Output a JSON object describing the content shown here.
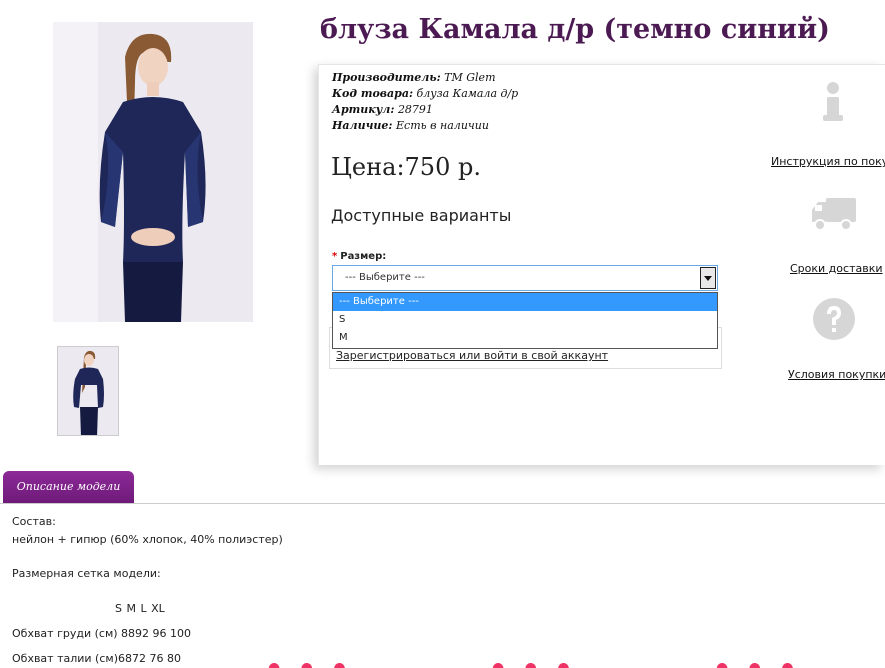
{
  "product": {
    "title": "блуза Камала д/р (темно синий)",
    "specs": [
      {
        "label": "Производитель:",
        "value": "TM Glem"
      },
      {
        "label": "Код товара:",
        "value": "блуза Камала д/р"
      },
      {
        "label": "Артикул:",
        "value": "28791"
      },
      {
        "label": "Наличие:",
        "value": "Есть в наличии"
      }
    ],
    "price": "Цена:750 р.",
    "variants_title": "Доступные варианты",
    "size_label": "Размер:",
    "size_required_mark": "*",
    "select_value": "--- Выберите ---",
    "select_options": [
      "--- Выберите ---",
      "S",
      "M"
    ],
    "login_link": "Зарегистрироваться или войти в свой аккаунт"
  },
  "sidebar": {
    "items": [
      {
        "icon": "info-icon",
        "label": "Инструкция по покуп"
      },
      {
        "icon": "truck-icon",
        "label": "Сроки доставки"
      },
      {
        "icon": "question-icon",
        "label": "Условия покупки"
      }
    ]
  },
  "tabs": {
    "description_label": "Описание модели"
  },
  "description": {
    "composition_label": "Состав:",
    "composition_value": "нейлон + гипюр (60% хлопок, 40% полиэстер)",
    "size_grid_label": "Размерная сетка модели:",
    "size_header": "S  M  L  XL",
    "rows": [
      {
        "label": "Обхват груди (см)",
        "values": "8892 96 100"
      },
      {
        "label": "Обхват талии (см)",
        "values": "6872 76  80"
      }
    ]
  },
  "colors": {
    "title": "#4c1a52",
    "tab": "#7e2289",
    "select_highlight": "#3399ff"
  }
}
